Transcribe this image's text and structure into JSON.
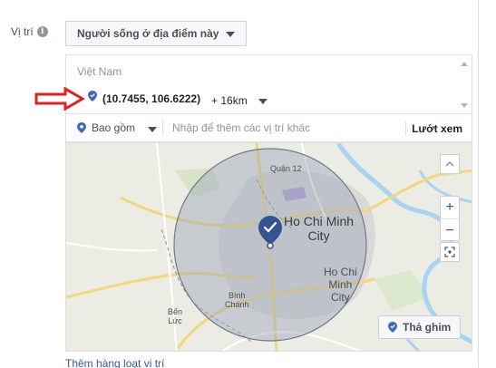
{
  "location_label": "Vị trí",
  "audience_dropdown": "Người sống ở địa điểm này",
  "locations": {
    "country": "Việt Nam",
    "pin_coords": "(10.7455, 106.6222)",
    "radius": "+ 16km"
  },
  "search": {
    "include_label": "Bao gồm",
    "placeholder": "Nhập để thêm các vị trí khác",
    "browse_label": "Lướt xem"
  },
  "map": {
    "labels": {
      "district12": "Quận 12",
      "hcm_city_big": "Ho Chi Minh\nCity",
      "hcm_city_small": "Ho Chi\nMinh\nCity",
      "binh_chanh": "Bình\nChánh",
      "ben_luc": "Bến\nLức"
    },
    "zoom_in": "+",
    "zoom_out": "−",
    "drop_pin_label": "Thả ghim"
  },
  "bulk_link": "Thêm hàng loạt vị trí",
  "colors": {
    "accent": "#4267b2",
    "radius_fill": "#9ea7b8",
    "arrow": "#e02020"
  }
}
